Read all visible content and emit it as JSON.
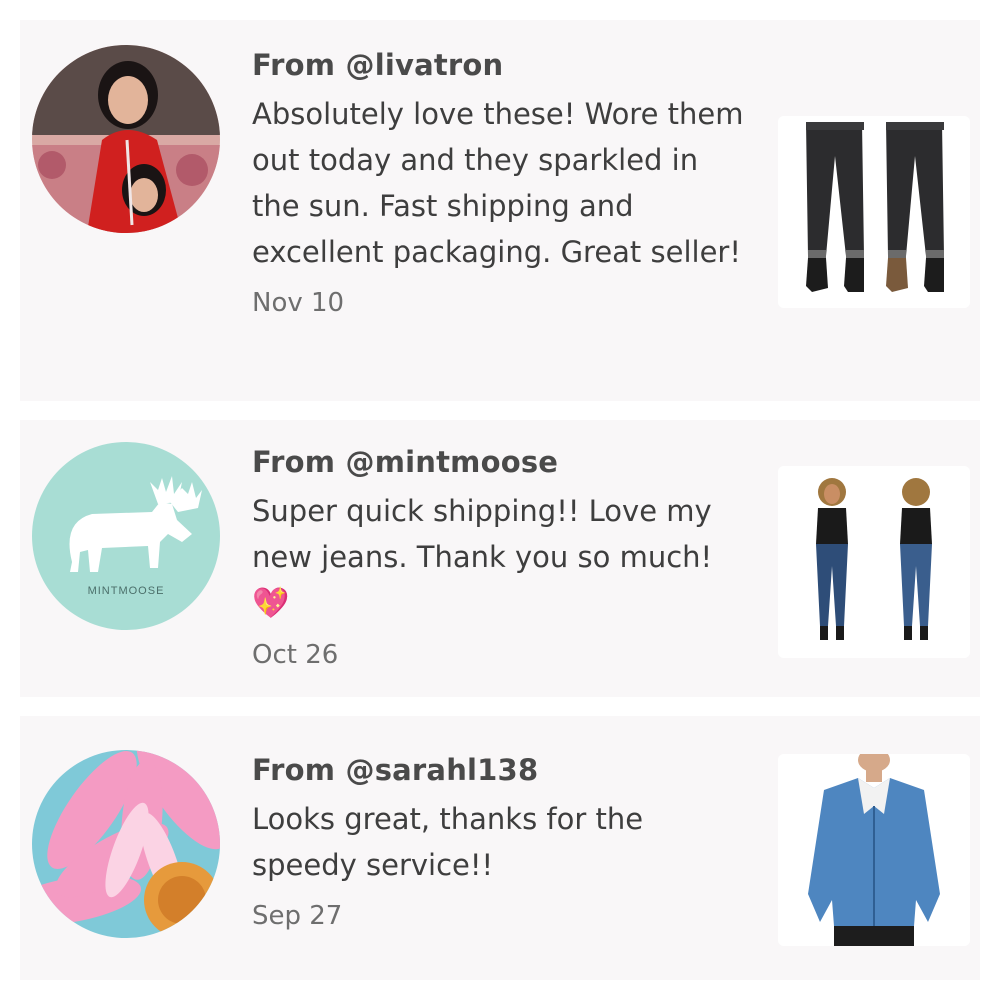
{
  "reviews": [
    {
      "from": "From @livatron",
      "text": "Absolutely love these! Wore them out today and they sparkled in the sun. Fast shipping and excellent packaging. Great seller!",
      "date": "Nov 10",
      "avatar_icon": "user-photo-avatar",
      "product_icon": "black-jeans-product"
    },
    {
      "from": "From @mintmoose",
      "text": "Super quick shipping!! Love my new jeans. Thank you so much!",
      "emoji": "💖",
      "date": "Oct 26",
      "avatar_icon": "moose-logo-avatar",
      "avatar_logo_text": "MINTMOOSE",
      "product_icon": "blue-jeans-model-product"
    },
    {
      "from": "From @sarahl138",
      "text": "Looks great, thanks for the speedy service!!",
      "date": "Sep 27",
      "avatar_icon": "pink-flower-avatar",
      "product_icon": "blue-jacket-product"
    }
  ],
  "colors": {
    "card_bg": "#f9f7f8",
    "mint": "#a8ddd4",
    "accent_pink": "#e0439a"
  }
}
